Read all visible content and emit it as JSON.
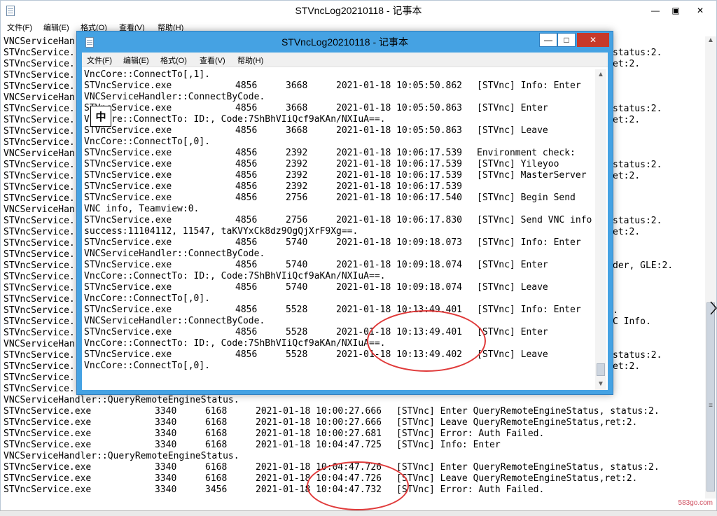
{
  "background_window": {
    "title": "STVncLog20210118 - 记事本",
    "menu": [
      "文件(F)",
      "编辑(E)",
      "格式(O)",
      "查看(V)",
      "帮助(H)"
    ],
    "buttons": {
      "minimize": "—",
      "maximize": "▣",
      "close": "✕"
    },
    "lines": [
      {
        "t": "VNCServiceHan"
      },
      {
        "t": "STVncService.",
        "r": "status:2."
      },
      {
        "t": "STVncService.",
        "r": "et:2."
      },
      {
        "t": "STVncService."
      },
      {
        "t": "STVncService."
      },
      {
        "t": "VNCServiceHan"
      },
      {
        "t": "STVncService.",
        "r": "status:2."
      },
      {
        "t": "STVncService.",
        "r": "et:2."
      },
      {
        "t": "STVncService."
      },
      {
        "t": "STVncService."
      },
      {
        "t": "VNCServiceHan"
      },
      {
        "t": "STVncService.",
        "r": "status:2."
      },
      {
        "t": "STVncService.",
        "r": "et:2."
      },
      {
        "t": "STVncService."
      },
      {
        "t": "STVncService."
      },
      {
        "t": "VNCServiceHan"
      },
      {
        "t": "STVncService.",
        "r": "status:2."
      },
      {
        "t": "STVncService.",
        "r": "et:2."
      },
      {
        "t": "STVncService."
      },
      {
        "t": "STVncService."
      },
      {
        "t": "STVncService.",
        "r": "der, GLE:2."
      },
      {
        "t": "STVncService."
      },
      {
        "t": "STVncService."
      },
      {
        "t": "STVncService."
      },
      {
        "t": "STVncService.",
        "r": "."
      },
      {
        "t": "STVncService.",
        "r": "C Info."
      },
      {
        "t": "STVncService."
      },
      {
        "t": "VNCServiceHan"
      },
      {
        "t": "STVncService.",
        "r": "status:2."
      },
      {
        "t": "STVncService.",
        "r": "et:2."
      },
      {
        "t": "STVncService."
      },
      {
        "t": "STVncService."
      },
      {
        "t": "VNCServiceHandler::QueryRemoteEngineStatus."
      },
      {
        "t": "STVncService.exe",
        "pid": "3340",
        "tid": "6168",
        "dt": "2021-01-18 10:00:27.666",
        "msg": "[STVnc] Enter QueryRemoteEngineStatus, status:2."
      },
      {
        "t": "STVncService.exe",
        "pid": "3340",
        "tid": "6168",
        "dt": "2021-01-18 10:00:27.666",
        "msg": "[STVnc] Leave QueryRemoteEngineStatus,ret:2."
      },
      {
        "t": "STVncService.exe",
        "pid": "3340",
        "tid": "6168",
        "dt": "2021-01-18 10:00:27.681",
        "msg": "[STVnc] Error: Auth Failed."
      },
      {
        "t": "STVncService.exe",
        "pid": "3340",
        "tid": "6168",
        "dt": "2021-01-18 10:04:47.725",
        "msg": "[STVnc] Info: Enter"
      },
      {
        "t": "VNCServiceHandler::QueryRemoteEngineStatus."
      },
      {
        "t": "STVncService.exe",
        "pid": "3340",
        "tid": "6168",
        "dt": "2021-01-18 10:04:47.726",
        "msg": "[STVnc] Enter QueryRemoteEngineStatus, status:2."
      },
      {
        "t": "STVncService.exe",
        "pid": "3340",
        "tid": "6168",
        "dt": "2021-01-18 10:04:47.726",
        "msg": "[STVnc] Leave QueryRemoteEngineStatus,ret:2."
      },
      {
        "t": "STVncService.exe",
        "pid": "3340",
        "tid": "3456",
        "dt": "2021-01-18 10:04:47.732",
        "msg": "[STVnc] Error: Auth Failed."
      }
    ]
  },
  "foreground_window": {
    "title": "STVncLog20210118 - 记事本",
    "menu": [
      "文件(F)",
      "编辑(E)",
      "格式(O)",
      "查看(V)",
      "帮助(H)"
    ],
    "buttons": {
      "minimize": "—",
      "maximize": "□",
      "close": "✕"
    },
    "ime_indicator": "中",
    "lines": [
      {
        "t": "VncCore::ConnectTo[,1]."
      },
      {
        "t": "STVncService.exe",
        "pid": "4856",
        "tid": "3668",
        "dt": "2021-01-18 10:05:50.862",
        "msg": "[STVnc] Info: Enter"
      },
      {
        "t": "VNCServiceHandler::ConnectByCode."
      },
      {
        "t": "STVncService.exe",
        "pid": "4856",
        "tid": "3668",
        "dt": "2021-01-18 10:05:50.863",
        "msg": "[STVnc] Enter"
      },
      {
        "t": "VncCore::ConnectTo: ID:, Code:7ShBhVIiQcf9aKAn/NXIuA==."
      },
      {
        "t": "STVncService.exe",
        "pid": "4856",
        "tid": "3668",
        "dt": "2021-01-18 10:05:50.863",
        "msg": "[STVnc] Leave"
      },
      {
        "t": "VncCore::ConnectTo[,0]."
      },
      {
        "t": "STVncService.exe",
        "pid": "4856",
        "tid": "2392",
        "dt": "2021-01-18 10:06:17.539",
        "msg": "Environment check:"
      },
      {
        "t": "STVncService.exe",
        "pid": "4856",
        "tid": "2392",
        "dt": "2021-01-18 10:06:17.539",
        "msg": "[STVnc] Yileyoo"
      },
      {
        "t": "STVncService.exe",
        "pid": "4856",
        "tid": "2392",
        "dt": "2021-01-18 10:06:17.539",
        "msg": "[STVnc] MasterServer"
      },
      {
        "t": "STVncService.exe",
        "pid": "4856",
        "tid": "2392",
        "dt": "2021-01-18 10:06:17.539",
        "msg": ""
      },
      {
        "t": "STVncService.exe",
        "pid": "4856",
        "tid": "2756",
        "dt": "2021-01-18 10:06:17.540",
        "msg": "[STVnc] Begin Send"
      },
      {
        "t": "VNC info, Teamview:0."
      },
      {
        "t": "STVncService.exe",
        "pid": "4856",
        "tid": "2756",
        "dt": "2021-01-18 10:06:17.830",
        "msg": "[STVnc] Send VNC info"
      },
      {
        "t": "success:11104112, 11547, taKVYxCk8dz9OgQjXrF9Xg==."
      },
      {
        "t": "STVncService.exe",
        "pid": "4856",
        "tid": "5740",
        "dt": "2021-01-18 10:09:18.073",
        "msg": "[STVnc] Info: Enter"
      },
      {
        "t": "VNCServiceHandler::ConnectByCode."
      },
      {
        "t": "STVncService.exe",
        "pid": "4856",
        "tid": "5740",
        "dt": "2021-01-18 10:09:18.074",
        "msg": "[STVnc] Enter"
      },
      {
        "t": "VncCore::ConnectTo: ID:, Code:7ShBhVIiQcf9aKAn/NXIuA==."
      },
      {
        "t": "STVncService.exe",
        "pid": "4856",
        "tid": "5740",
        "dt": "2021-01-18 10:09:18.074",
        "msg": "[STVnc] Leave"
      },
      {
        "t": "VncCore::ConnectTo[,0]."
      },
      {
        "t": "STVncService.exe",
        "pid": "4856",
        "tid": "5528",
        "dt": "2021-01-18 10:13:49.401",
        "msg": "[STVnc] Info: Enter"
      },
      {
        "t": "VNCServiceHandler::ConnectByCode."
      },
      {
        "t": "STVncService.exe",
        "pid": "4856",
        "tid": "5528",
        "dt": "2021-01-18 10:13:49.401",
        "msg": "[STVnc] Enter"
      },
      {
        "t": "VncCore::ConnectTo: ID:, Code:7ShBhVIiQcf9aKAn/NXIuA==."
      },
      {
        "t": "STVncService.exe",
        "pid": "4856",
        "tid": "5528",
        "dt": "2021-01-18 10:13:49.402",
        "msg": "[STVnc] Leave"
      },
      {
        "t": "VncCore::ConnectTo[,0]."
      }
    ]
  },
  "watermark": "583go.com",
  "colors": {
    "accent": "#45a2e3",
    "annotation": "#e03a3a",
    "close_button": "#c7392a"
  }
}
